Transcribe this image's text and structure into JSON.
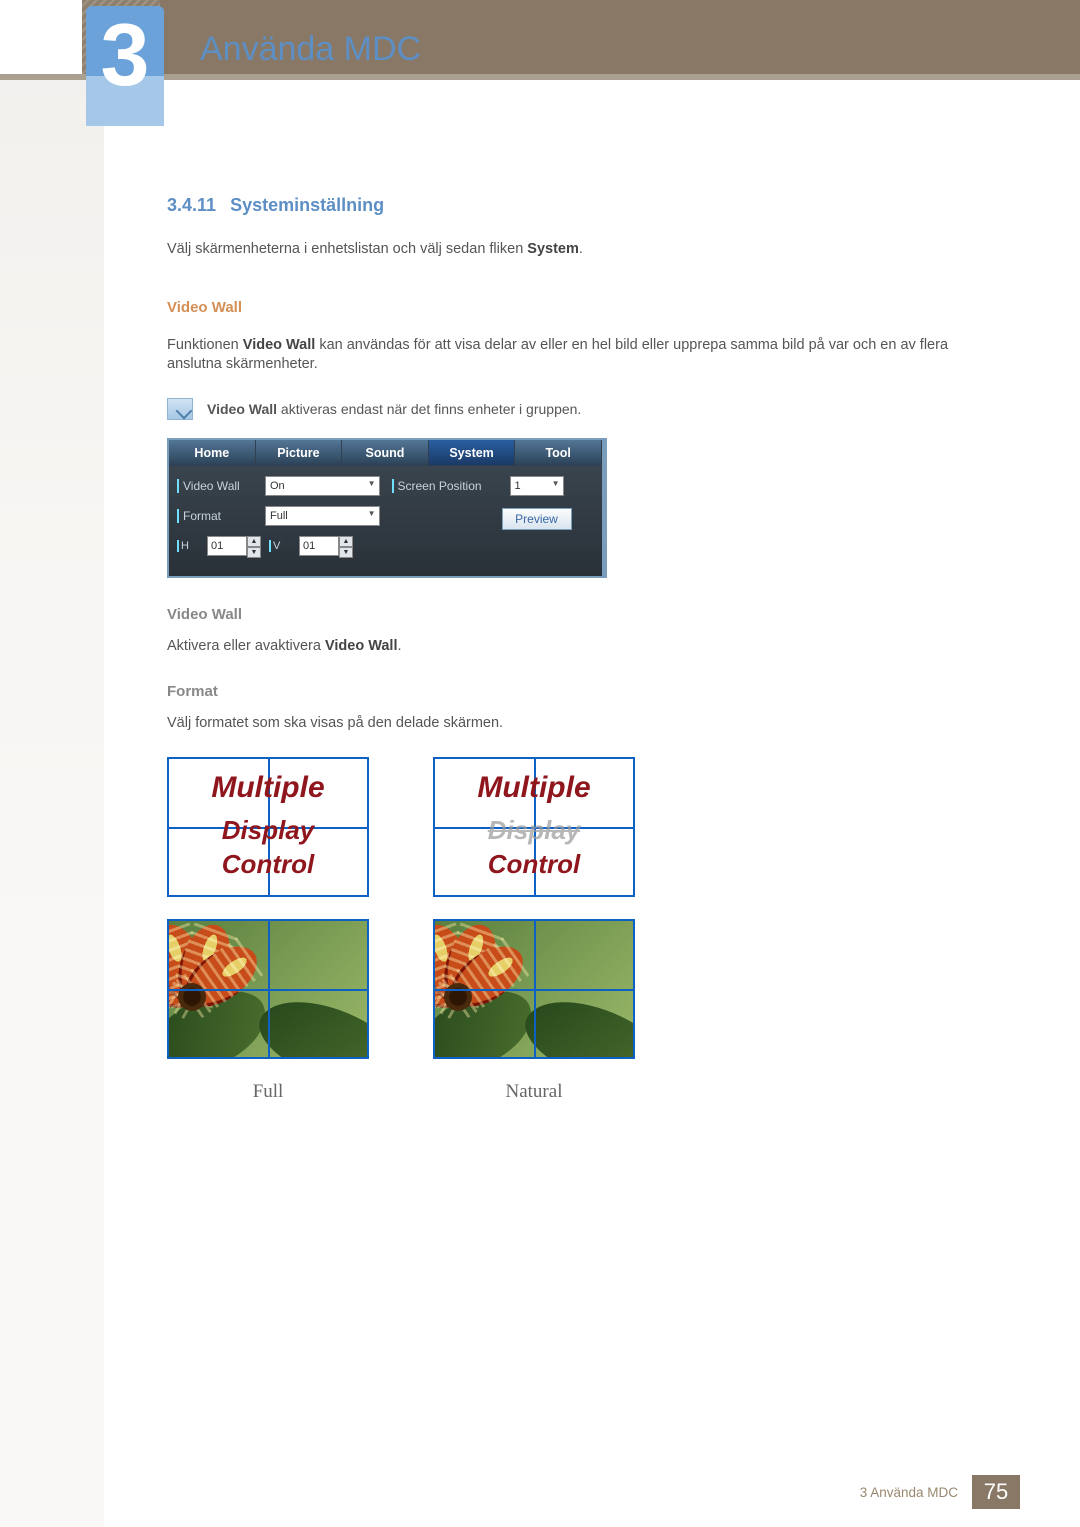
{
  "chapter": {
    "number": "3",
    "title": "Använda MDC"
  },
  "section": {
    "number": "3.4.11",
    "title": "Systeminställning"
  },
  "intro_pre": "Välj skärmenheterna i enhetslistan och välj sedan fliken ",
  "intro_bold": "System",
  "intro_post": ".",
  "video_wall_heading": "Video Wall",
  "vw_desc_pre": "Funktionen ",
  "vw_desc_bold": "Video Wall",
  "vw_desc_post": " kan användas för att visa delar av eller en hel bild eller upprepa samma bild på var och en av flera anslutna skärmenheter.",
  "note_bold": "Video Wall",
  "note_rest": " aktiveras endast när det finns enheter i gruppen.",
  "ui": {
    "tabs": [
      "Home",
      "Picture",
      "Sound",
      "System",
      "Tool"
    ],
    "video_wall_label": "Video Wall",
    "video_wall_value": "On",
    "format_label": "Format",
    "format_value": "Full",
    "h_label": "H",
    "h_value": "01",
    "v_label": "V",
    "v_value": "01",
    "screen_position_label": "Screen Position",
    "screen_position_value": "1",
    "preview_label": "Preview"
  },
  "vw_sub": "Video Wall",
  "vw_sub_text_pre": "Aktivera eller avaktivera ",
  "vw_sub_text_bold": "Video Wall",
  "vw_sub_text_post": ".",
  "format_sub": "Format",
  "format_text": "Välj formatet som ska visas på den delade skärmen.",
  "mdc": {
    "line1": "Multiple",
    "line2": "Display",
    "line3": "Control"
  },
  "captions": {
    "full": "Full",
    "natural": "Natural"
  },
  "footer": {
    "label": "3 Använda MDC",
    "page": "75"
  }
}
